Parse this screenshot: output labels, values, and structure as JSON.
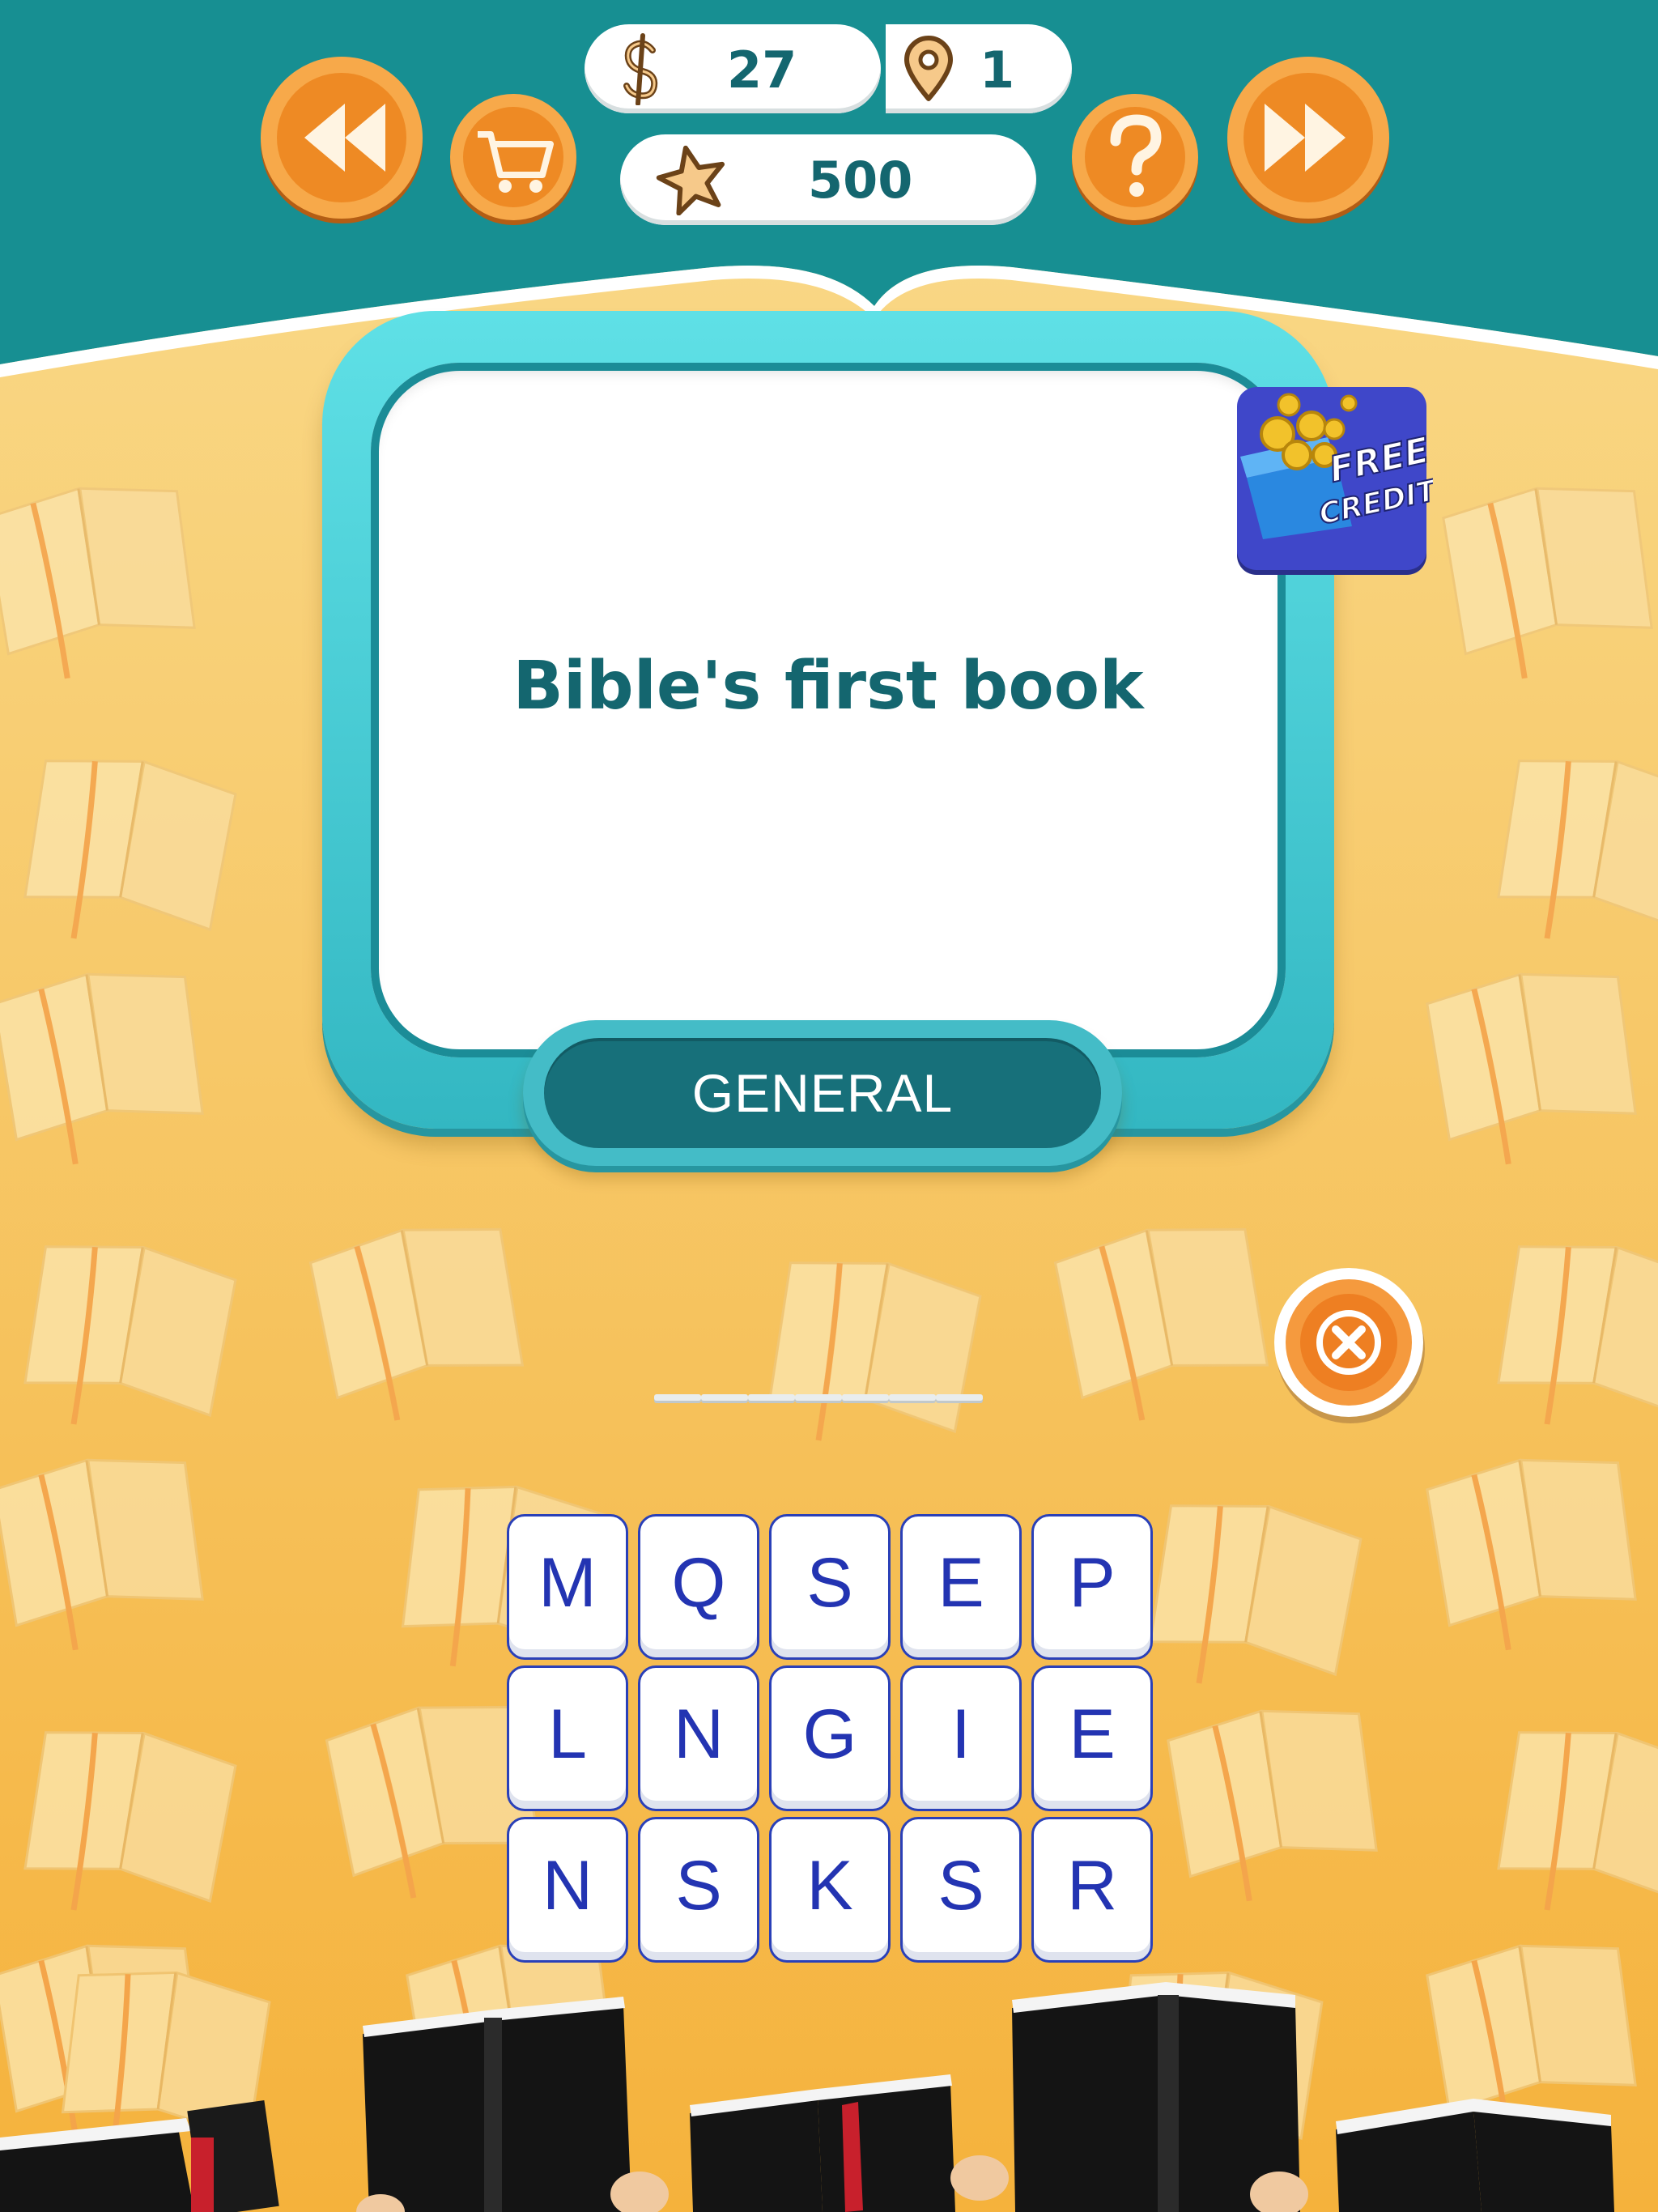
{
  "header": {
    "money": "27",
    "level": "1",
    "stars": "500",
    "icons": {
      "back": "rewind-icon",
      "shop": "shopping-cart-icon",
      "money": "dollar-sign-icon",
      "level": "location-pin-icon",
      "stars": "star-icon",
      "help": "question-mark-icon",
      "skip": "fast-forward-icon"
    }
  },
  "free_credits": {
    "line1": "FREE",
    "line2": "CREDITS"
  },
  "question": {
    "text": "Bible's first book",
    "category": "GENERAL"
  },
  "answer": {
    "slots": 7
  },
  "tiles": [
    [
      "M",
      "Q",
      "S",
      "E",
      "P"
    ],
    [
      "L",
      "N",
      "G",
      "I",
      "E"
    ],
    [
      "N",
      "S",
      "K",
      "S",
      "R"
    ]
  ],
  "colors": {
    "header_teal": "#178f92",
    "orange_button": "#f0922a",
    "card_frame": "#3cc2cc",
    "tile_letter": "#2334b2",
    "text_teal": "#14666f"
  }
}
